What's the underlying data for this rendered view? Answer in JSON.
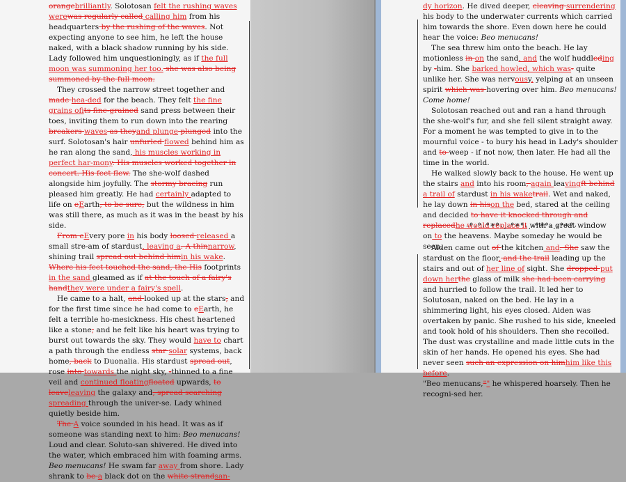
{
  "left_page": {
    "paragraphs": [
      {
        "indent": false,
        "fragments": [
          {
            "t": "orange",
            "s": "del"
          },
          {
            "t": "brilliantly",
            "s": "ins"
          },
          {
            "t": ". Solotosan ",
            "s": "n"
          },
          {
            "t": "felt the rushing waves were",
            "s": "ins"
          },
          {
            "t": "was regularly called",
            "s": "del"
          },
          {
            "t": " calling him",
            "s": "ins"
          },
          {
            "t": " from his headquarters",
            "s": "n"
          },
          {
            "t": " by the rushing of the waves",
            "s": "del"
          },
          {
            "t": ". Not expecting anyone to see him, he left the house naked, with a black shadow running by his side. Lady followed him unquestioningly, as if ",
            "s": "n"
          },
          {
            "t": "the full moon was summoning her too.",
            "s": "ins"
          },
          {
            "t": " she was also being summoned by the full moon.",
            "s": "del"
          }
        ]
      },
      {
        "indent": true,
        "fragments": [
          {
            "t": "They crossed the narrow street together and ",
            "s": "n"
          },
          {
            "t": "made ",
            "s": "del"
          },
          {
            "t": "hea-ded",
            "s": "ins"
          },
          {
            "t": " for the beach. They felt ",
            "s": "n"
          },
          {
            "t": "the fine grains of",
            "s": "ins"
          },
          {
            "t": "its fine-grained",
            "s": "del"
          },
          {
            "t": " sand press between their toes, inviting them to run down into the rearing ",
            "s": "n"
          },
          {
            "t": "breakers ",
            "s": "del"
          },
          {
            "t": "waves",
            "s": "ins"
          },
          {
            "t": " as they",
            "s": "del"
          },
          {
            "t": "and plunge",
            "s": "ins"
          },
          {
            "t": " plunged",
            "s": "del"
          },
          {
            "t": " into the surf. Solotosan's hair ",
            "s": "n"
          },
          {
            "t": "unfurled ",
            "s": "del"
          },
          {
            "t": "flowed",
            "s": "ins"
          },
          {
            "t": " behind him as he ran along the sand,",
            "s": "n"
          },
          {
            "t": " his muscles working in perfect har-mony",
            "s": "ins"
          },
          {
            "t": ". His muscles worked together in concert. His feet flew.",
            "s": "del"
          },
          {
            "t": " The she-wolf dashed alongside him joyfully. The ",
            "s": "n"
          },
          {
            "t": "stormy bracing",
            "s": "del"
          },
          {
            "t": " run pleased him greatly. He had ",
            "s": "n"
          },
          {
            "t": "certainly ",
            "s": "ins"
          },
          {
            "t": "adapted to life on ",
            "s": "n"
          },
          {
            "t": "e",
            "s": "del"
          },
          {
            "t": "E",
            "s": "ins"
          },
          {
            "t": "arth",
            "s": "n"
          },
          {
            "t": ", to be sure,",
            "s": "del"
          },
          {
            "t": " but the wildness in him was still there, as much as it was in the beast by his side.",
            "s": "n"
          }
        ]
      },
      {
        "indent": true,
        "fragments": [
          {
            "t": "From e",
            "s": "del"
          },
          {
            "t": "E",
            "s": "ins"
          },
          {
            "t": "very pore ",
            "s": "n"
          },
          {
            "t": "in",
            "s": "ins"
          },
          {
            "t": " his body ",
            "s": "n"
          },
          {
            "t": "loosed ",
            "s": "del"
          },
          {
            "t": "released ",
            "s": "ins"
          },
          {
            "t": " a small stre-am of stardust",
            "s": "n"
          },
          {
            "t": ", leaving a",
            "s": "ins"
          },
          {
            "t": ". A thin",
            "s": "del"
          },
          {
            "t": "narrow",
            "s": "ins"
          },
          {
            "t": ", shining trail ",
            "s": "n"
          },
          {
            "t": "spread out behind him",
            "s": "del"
          },
          {
            "t": "in his wake",
            "s": "ins"
          },
          {
            "t": ". ",
            "s": "n"
          },
          {
            "t": "Where his feet touched the sand, the His",
            "s": "del"
          },
          {
            "t": " footprints ",
            "s": "n"
          },
          {
            "t": "in the sand ",
            "s": "ins"
          },
          {
            "t": "gleamed as if ",
            "s": "n"
          },
          {
            "t": "at the touch of a fairy's hand",
            "s": "del"
          },
          {
            "t": "they were under a fairy's spell",
            "s": "ins"
          },
          {
            "t": ".",
            "s": "n"
          }
        ]
      },
      {
        "indent": true,
        "fragments": [
          {
            "t": "He came to a halt, ",
            "s": "n"
          },
          {
            "t": "and ",
            "s": "del"
          },
          {
            "t": "looked up at the stars",
            "s": "n"
          },
          {
            "t": ",",
            "s": "del"
          },
          {
            "t": " and for the first time since he had come to ",
            "s": "n"
          },
          {
            "t": "e",
            "s": "del"
          },
          {
            "t": "E",
            "s": "ins"
          },
          {
            "t": "arth, he felt a terrible ho-mesickness. His chest heartened like a stone",
            "s": "n"
          },
          {
            "t": ",",
            "s": "del"
          },
          {
            "t": " and he felt like his heart was trying to burst out towards the sky. They would ",
            "s": "n"
          },
          {
            "t": "have to",
            "s": "ins"
          },
          {
            "t": " chart a path through the endless ",
            "s": "n"
          },
          {
            "t": "star ",
            "s": "del"
          },
          {
            "t": "solar",
            "s": "ins"
          },
          {
            "t": " systems, back home",
            "s": "n"
          },
          {
            "t": ", back",
            "s": "del"
          },
          {
            "t": " to Duonalia. His stardust ",
            "s": "n"
          },
          {
            "t": "spread out",
            "s": "del"
          },
          {
            "t": ", rose ",
            "s": "n"
          },
          {
            "t": "into ",
            "s": "del"
          },
          {
            "t": "towards ",
            "s": "ins"
          },
          {
            "t": "the night sky, ",
            "s": "n"
          },
          {
            "t": "-",
            "s": "del"
          },
          {
            "t": "thinned to a fine veil and ",
            "s": "n"
          },
          {
            "t": "continued floating",
            "s": "ins"
          },
          {
            "t": "floated",
            "s": "del"
          },
          {
            "t": " upwards, ",
            "s": "n"
          },
          {
            "t": "to leave",
            "s": "del"
          },
          {
            "t": "leaving",
            "s": "ins"
          },
          {
            "t": " the galaxy and",
            "s": "n"
          },
          {
            "t": ", spread ",
            "s": "del"
          },
          {
            "t": "searching ",
            "s": "del"
          },
          {
            "t": "spreading ",
            "s": "ins"
          },
          {
            "t": "through the univer-se. Lady whined quietly beside him.",
            "s": "n"
          }
        ]
      },
      {
        "indent": true,
        "fragments": [
          {
            "t": "The ",
            "s": "del"
          },
          {
            "t": "A",
            "s": "ins"
          },
          {
            "t": " voice sounded in his head. It was as if someone was standing next to him: ",
            "s": "n"
          },
          {
            "t": "Beo menucans!",
            "s": "it"
          },
          {
            "t": " Loud and clear. Soluto-san shivered. He dived into the water, which embraced him with foaming arms. ",
            "s": "n"
          },
          {
            "t": "Beo menucans!",
            "s": "it"
          },
          {
            "t": " He swam far ",
            "s": "n"
          },
          {
            "t": "away ",
            "s": "ins"
          },
          {
            "t": "from shore. Lady shrank to ",
            "s": "n"
          },
          {
            "t": "be ",
            "s": "del"
          },
          {
            "t": "a",
            "s": "ins"
          },
          {
            "t": " black dot on the ",
            "s": "n"
          },
          {
            "t": "white strand",
            "s": "del"
          },
          {
            "t": "san-",
            "s": "ins"
          }
        ]
      }
    ]
  },
  "right_page": {
    "paragraphs": [
      {
        "indent": false,
        "fragments": [
          {
            "t": "dy horizon",
            "s": "ins"
          },
          {
            "t": ". He dived deeper, ",
            "s": "n"
          },
          {
            "t": "cleaving ",
            "s": "del"
          },
          {
            "t": "surrendering ",
            "s": "ins"
          },
          {
            "t": "his body to the underwater currents which carried him towards the shore. Even down here he could hear the voice: ",
            "s": "n"
          },
          {
            "t": "Beo menucans!",
            "s": "it"
          }
        ]
      },
      {
        "indent": true,
        "fragments": [
          {
            "t": "The sea threw him onto the beach. He lay motionless ",
            "s": "n"
          },
          {
            "t": "in ",
            "s": "del"
          },
          {
            "t": "on",
            "s": "ins"
          },
          {
            "t": " the sand",
            "s": "n"
          },
          {
            "t": ", and",
            "s": "ins"
          },
          {
            "t": " the wolf huddl",
            "s": "n"
          },
          {
            "t": "ed",
            "s": "del"
          },
          {
            "t": "ing",
            "s": "ins"
          },
          {
            "t": " by ",
            "s": "n"
          },
          {
            "t": "-",
            "s": "del"
          },
          {
            "t": "him. She ",
            "s": "n"
          },
          {
            "t": "barked howled, which was",
            "s": "ins"
          },
          {
            "t": "-",
            "s": "del"
          },
          {
            "t": " quite unlike her. She was nerv",
            "s": "n"
          },
          {
            "t": "ous",
            "s": "ins"
          },
          {
            "t": "y",
            "s": "n"
          },
          {
            "t": ",",
            "s": "ins"
          },
          {
            "t": " yelping at an unseen spirit ",
            "s": "n"
          },
          {
            "t": "which was ",
            "s": "del"
          },
          {
            "t": "hovering over him. ",
            "s": "n"
          },
          {
            "t": "Beo menucans! Come home!",
            "s": "it"
          }
        ]
      },
      {
        "indent": true,
        "fragments": [
          {
            "t": "Solotosan reached out and ran a hand through the she-wolf's fur, and she fell silent straight away. For a moment he was tempted to give in to the mournful voice - to bury his head in Lady's shoulder and ",
            "s": "n"
          },
          {
            "t": "to ",
            "s": "del"
          },
          {
            "t": "weep - if not now, then later. He had all the time in the world.",
            "s": "n"
          }
        ]
      },
      {
        "indent": true,
        "fragments": [
          {
            "t": "He walked slowly back to the house. He went up the stairs ",
            "s": "n"
          },
          {
            "t": "and",
            "s": "ins"
          },
          {
            "t": " into his room",
            "s": "n"
          },
          {
            "t": ", ",
            "s": "del"
          },
          {
            "t": " again ",
            "s": "ins"
          },
          {
            "t": "lea",
            "s": "n"
          },
          {
            "t": "ving",
            "s": "ins"
          },
          {
            "t": "ft behind ",
            "s": "del"
          },
          {
            "t": "a trail of",
            "s": "ins"
          },
          {
            "t": " stardust ",
            "s": "n"
          },
          {
            "t": "in his wake",
            "s": "ins"
          },
          {
            "t": "trail",
            "s": "del"
          },
          {
            "t": ". Wet and naked, he lay down ",
            "s": "n"
          },
          {
            "t": "in his",
            "s": "del"
          },
          {
            "t": "on the",
            "s": "ins"
          },
          {
            "t": " bed, stared at the ceiling and decided ",
            "s": "n"
          },
          {
            "t": "to have it knocked through and replaced",
            "s": "del"
          },
          {
            "t": "he would replace it",
            "s": "ins"
          },
          {
            "t": " with a great window on",
            "s": "n"
          },
          {
            "t": " to",
            "s": "ins"
          },
          {
            "t": " the heavens. Maybe someday he would be seen.",
            "s": "n"
          }
        ]
      }
    ],
    "ornament": "·°·°·°*°·.·°*°·.·°*°·.·°*°·",
    "paragraphs2": [
      {
        "indent": true,
        "fragments": [
          {
            "t": "Aiden came out ",
            "s": "n"
          },
          {
            "t": "of ",
            "s": "del"
          },
          {
            "t": "the kitchen",
            "s": "n"
          },
          {
            "t": " and",
            "s": "ins"
          },
          {
            "t": ". She",
            "s": "del"
          },
          {
            "t": " saw the stardust on the floor",
            "s": "n"
          },
          {
            "t": ",",
            "s": "ins"
          },
          {
            "t": " and the trail",
            "s": "del"
          },
          {
            "t": " leading up the stairs and out of ",
            "s": "n"
          },
          {
            "t": "her line of",
            "s": "ins"
          },
          {
            "t": " sight. She ",
            "s": "n"
          },
          {
            "t": "dropped ",
            "s": "del"
          },
          {
            "t": "put down her",
            "s": "ins"
          },
          {
            "t": "the",
            "s": "del"
          },
          {
            "t": " glass of milk ",
            "s": "n"
          },
          {
            "t": "she had been carrying ",
            "s": "del"
          },
          {
            "t": "and hurried to follow the trail. It led her to Solutosan, naked on the bed. He lay in a shimmering light, his eyes closed. Aiden was overtaken by panic. She rushed to his side, kneeled and took hold of his shoulders. Then she recoiled. The dust was crystalline and made little cuts in the skin of her hands. He opened his eyes. She had never seen ",
            "s": "n"
          },
          {
            "t": "such an expression on him",
            "s": "del"
          },
          {
            "t": "him like this before",
            "s": "ins"
          },
          {
            "t": ".",
            "s": "n"
          }
        ]
      },
      {
        "indent": false,
        "fragments": [
          {
            "t": "\"Beo menucans,",
            "s": "n"
          },
          {
            "t": "\"",
            "s": "del"
          },
          {
            "t": "\"",
            "s": "ins"
          },
          {
            "t": " he whispered hoarsely. Then he recogni-sed her.",
            "s": "n"
          }
        ]
      }
    ]
  }
}
